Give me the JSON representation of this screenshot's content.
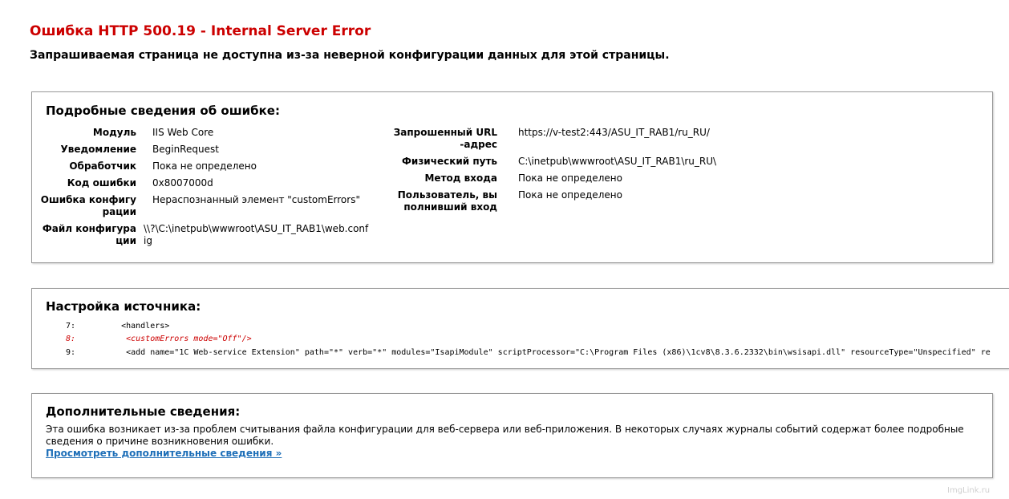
{
  "error": {
    "title": "Ошибка HTTP 500.19 - Internal Server Error",
    "subtitle": "Запрашиваемая страница не доступна из-за неверной конфигурации данных для этой страницы."
  },
  "details": {
    "heading": "Подробные сведения об ошибке:",
    "left": [
      {
        "label": "Модуль",
        "value": "IIS Web Core"
      },
      {
        "label": "Уведомление",
        "value": "BeginRequest"
      },
      {
        "label": "Обработчик",
        "value": "Пока не определено"
      },
      {
        "label": "Код ошибки",
        "value": "0x8007000d"
      },
      {
        "label": "Ошибка конфигурации",
        "value": "Нераспознанный элемент \"customErrors\""
      },
      {
        "label": "Файл конфигурации",
        "value": "\\\\?\\C:\\inetpub\\wwwroot\\ASU_IT_RAB1\\web.config"
      }
    ],
    "right": [
      {
        "label": "Запрошенный URL-адрес",
        "value": "https://v-test2:443/ASU_IT_RAB1/ru_RU/"
      },
      {
        "label": "Физический путь",
        "value": "C:\\inetpub\\wwwroot\\ASU_IT_RAB1\\ru_RU\\"
      },
      {
        "label": "Метод входа",
        "value": "Пока не определено"
      },
      {
        "label": "Пользователь, вы полнивший вход",
        "value": "Пока не определено"
      }
    ]
  },
  "source": {
    "heading": "Настройка источника:",
    "lines": [
      {
        "num": "7:",
        "code": "    <handlers>",
        "highlight": false
      },
      {
        "num": "8:",
        "code": "     <customErrors mode=\"Off\"/>",
        "highlight": true
      },
      {
        "num": "9:",
        "code": "     <add name=\"1C Web-service Extension\" path=\"*\" verb=\"*\" modules=\"IsapiModule\" scriptProcessor=\"C:\\Program Files (x86)\\1cv8\\8.3.6.2332\\bin\\wsisapi.dll\" resourceType=\"Unspecified\" re",
        "highlight": false
      }
    ]
  },
  "more": {
    "heading": "Дополнительные сведения:",
    "text": "Эта ошибка возникает из-за проблем считывания файла конфигурации для веб-сервера или веб-приложения. В некоторых случаях журналы событий содержат более подробные сведения о причине возникновения ошибки.",
    "link": "Просмотреть дополнительные сведения »"
  },
  "watermark": "ImgLink.ru"
}
